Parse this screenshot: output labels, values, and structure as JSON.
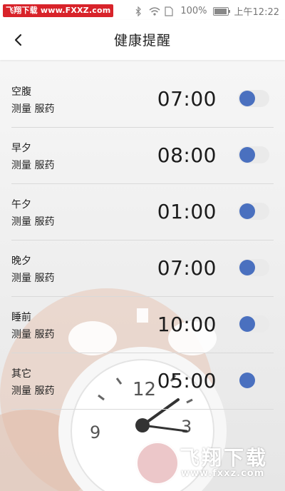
{
  "status_bar": {
    "watermark_left": "飞翔下载",
    "watermark_url": "www.FXXZ.com",
    "battery": "100%",
    "time": "上午12:22"
  },
  "header": {
    "title": "健康提醒"
  },
  "reminders": [
    {
      "name": "空腹",
      "actions": "测量 服药",
      "time": "07:00",
      "enabled": true
    },
    {
      "name": "早夕",
      "actions": "测量 服药",
      "time": "08:00",
      "enabled": true
    },
    {
      "name": "午夕",
      "actions": "测量 服药",
      "time": "01:00",
      "enabled": true
    },
    {
      "name": "晚夕",
      "actions": "测量 服药",
      "time": "07:00",
      "enabled": true
    },
    {
      "name": "睡前",
      "actions": "测量 服药",
      "time": "10:00",
      "enabled": true
    },
    {
      "name": "其它",
      "actions": "测量 服药",
      "time": "05:00",
      "enabled": true
    }
  ],
  "watermark": {
    "title": "飞翔下载",
    "url": "www.fxxz.com"
  },
  "colors": {
    "toggle_knob": "#4a70bf",
    "toggle_track": "#eaeaea",
    "watermark_badge": "#d8232a"
  }
}
